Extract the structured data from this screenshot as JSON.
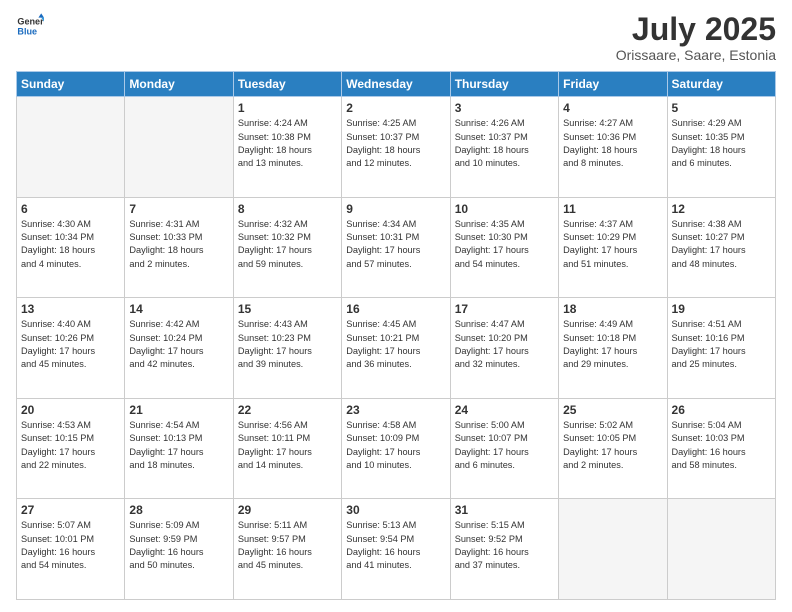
{
  "logo": {
    "general": "General",
    "blue": "Blue"
  },
  "title": "July 2025",
  "subtitle": "Orissaare, Saare, Estonia",
  "headers": [
    "Sunday",
    "Monday",
    "Tuesday",
    "Wednesday",
    "Thursday",
    "Friday",
    "Saturday"
  ],
  "weeks": [
    [
      {
        "day": "",
        "detail": ""
      },
      {
        "day": "",
        "detail": ""
      },
      {
        "day": "1",
        "detail": "Sunrise: 4:24 AM\nSunset: 10:38 PM\nDaylight: 18 hours\nand 13 minutes."
      },
      {
        "day": "2",
        "detail": "Sunrise: 4:25 AM\nSunset: 10:37 PM\nDaylight: 18 hours\nand 12 minutes."
      },
      {
        "day": "3",
        "detail": "Sunrise: 4:26 AM\nSunset: 10:37 PM\nDaylight: 18 hours\nand 10 minutes."
      },
      {
        "day": "4",
        "detail": "Sunrise: 4:27 AM\nSunset: 10:36 PM\nDaylight: 18 hours\nand 8 minutes."
      },
      {
        "day": "5",
        "detail": "Sunrise: 4:29 AM\nSunset: 10:35 PM\nDaylight: 18 hours\nand 6 minutes."
      }
    ],
    [
      {
        "day": "6",
        "detail": "Sunrise: 4:30 AM\nSunset: 10:34 PM\nDaylight: 18 hours\nand 4 minutes."
      },
      {
        "day": "7",
        "detail": "Sunrise: 4:31 AM\nSunset: 10:33 PM\nDaylight: 18 hours\nand 2 minutes."
      },
      {
        "day": "8",
        "detail": "Sunrise: 4:32 AM\nSunset: 10:32 PM\nDaylight: 17 hours\nand 59 minutes."
      },
      {
        "day": "9",
        "detail": "Sunrise: 4:34 AM\nSunset: 10:31 PM\nDaylight: 17 hours\nand 57 minutes."
      },
      {
        "day": "10",
        "detail": "Sunrise: 4:35 AM\nSunset: 10:30 PM\nDaylight: 17 hours\nand 54 minutes."
      },
      {
        "day": "11",
        "detail": "Sunrise: 4:37 AM\nSunset: 10:29 PM\nDaylight: 17 hours\nand 51 minutes."
      },
      {
        "day": "12",
        "detail": "Sunrise: 4:38 AM\nSunset: 10:27 PM\nDaylight: 17 hours\nand 48 minutes."
      }
    ],
    [
      {
        "day": "13",
        "detail": "Sunrise: 4:40 AM\nSunset: 10:26 PM\nDaylight: 17 hours\nand 45 minutes."
      },
      {
        "day": "14",
        "detail": "Sunrise: 4:42 AM\nSunset: 10:24 PM\nDaylight: 17 hours\nand 42 minutes."
      },
      {
        "day": "15",
        "detail": "Sunrise: 4:43 AM\nSunset: 10:23 PM\nDaylight: 17 hours\nand 39 minutes."
      },
      {
        "day": "16",
        "detail": "Sunrise: 4:45 AM\nSunset: 10:21 PM\nDaylight: 17 hours\nand 36 minutes."
      },
      {
        "day": "17",
        "detail": "Sunrise: 4:47 AM\nSunset: 10:20 PM\nDaylight: 17 hours\nand 32 minutes."
      },
      {
        "day": "18",
        "detail": "Sunrise: 4:49 AM\nSunset: 10:18 PM\nDaylight: 17 hours\nand 29 minutes."
      },
      {
        "day": "19",
        "detail": "Sunrise: 4:51 AM\nSunset: 10:16 PM\nDaylight: 17 hours\nand 25 minutes."
      }
    ],
    [
      {
        "day": "20",
        "detail": "Sunrise: 4:53 AM\nSunset: 10:15 PM\nDaylight: 17 hours\nand 22 minutes."
      },
      {
        "day": "21",
        "detail": "Sunrise: 4:54 AM\nSunset: 10:13 PM\nDaylight: 17 hours\nand 18 minutes."
      },
      {
        "day": "22",
        "detail": "Sunrise: 4:56 AM\nSunset: 10:11 PM\nDaylight: 17 hours\nand 14 minutes."
      },
      {
        "day": "23",
        "detail": "Sunrise: 4:58 AM\nSunset: 10:09 PM\nDaylight: 17 hours\nand 10 minutes."
      },
      {
        "day": "24",
        "detail": "Sunrise: 5:00 AM\nSunset: 10:07 PM\nDaylight: 17 hours\nand 6 minutes."
      },
      {
        "day": "25",
        "detail": "Sunrise: 5:02 AM\nSunset: 10:05 PM\nDaylight: 17 hours\nand 2 minutes."
      },
      {
        "day": "26",
        "detail": "Sunrise: 5:04 AM\nSunset: 10:03 PM\nDaylight: 16 hours\nand 58 minutes."
      }
    ],
    [
      {
        "day": "27",
        "detail": "Sunrise: 5:07 AM\nSunset: 10:01 PM\nDaylight: 16 hours\nand 54 minutes."
      },
      {
        "day": "28",
        "detail": "Sunrise: 5:09 AM\nSunset: 9:59 PM\nDaylight: 16 hours\nand 50 minutes."
      },
      {
        "day": "29",
        "detail": "Sunrise: 5:11 AM\nSunset: 9:57 PM\nDaylight: 16 hours\nand 45 minutes."
      },
      {
        "day": "30",
        "detail": "Sunrise: 5:13 AM\nSunset: 9:54 PM\nDaylight: 16 hours\nand 41 minutes."
      },
      {
        "day": "31",
        "detail": "Sunrise: 5:15 AM\nSunset: 9:52 PM\nDaylight: 16 hours\nand 37 minutes."
      },
      {
        "day": "",
        "detail": ""
      },
      {
        "day": "",
        "detail": ""
      }
    ]
  ]
}
